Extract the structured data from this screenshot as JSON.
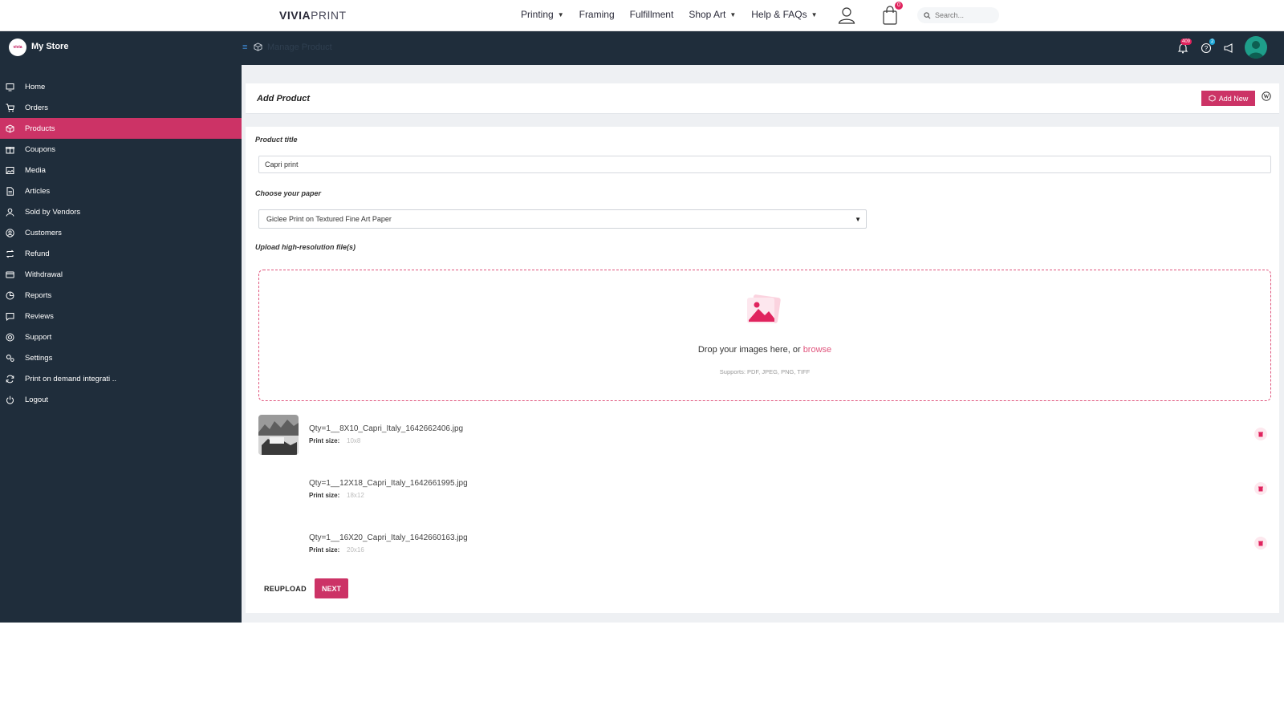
{
  "site": {
    "logo_bold": "VIVIA",
    "logo_light": "PRINT",
    "nav": [
      {
        "label": "Printing",
        "has_dropdown": true
      },
      {
        "label": "Framing",
        "has_dropdown": false
      },
      {
        "label": "Fulfillment",
        "has_dropdown": false
      },
      {
        "label": "Shop Art",
        "has_dropdown": true
      },
      {
        "label": "Help & FAQs",
        "has_dropdown": true
      }
    ],
    "cart_count": "0",
    "search_placeholder": "Search..."
  },
  "app": {
    "store_logo_text": "vivia",
    "store_name": "My Store",
    "header_title": "Manage Product",
    "notifications_count": "409",
    "help_count": "2",
    "accent_color": "#cc3366",
    "sidebar_bg": "#1f2d3b"
  },
  "sidebar": {
    "items": [
      {
        "label": "Home",
        "icon": "monitor-icon",
        "active": false
      },
      {
        "label": "Orders",
        "icon": "cart-icon",
        "active": false
      },
      {
        "label": "Products",
        "icon": "box-icon",
        "active": true
      },
      {
        "label": "Coupons",
        "icon": "gift-icon",
        "active": false
      },
      {
        "label": "Media",
        "icon": "image-icon",
        "active": false
      },
      {
        "label": "Articles",
        "icon": "document-icon",
        "active": false
      },
      {
        "label": "Sold by Vendors",
        "icon": "user-icon",
        "active": false
      },
      {
        "label": "Customers",
        "icon": "user-circle-icon",
        "active": false
      },
      {
        "label": "Refund",
        "icon": "retweet-icon",
        "active": false
      },
      {
        "label": "Withdrawal",
        "icon": "credit-card-icon",
        "active": false
      },
      {
        "label": "Reports",
        "icon": "pie-chart-icon",
        "active": false
      },
      {
        "label": "Reviews",
        "icon": "comment-icon",
        "active": false
      },
      {
        "label": "Support",
        "icon": "life-ring-icon",
        "active": false
      },
      {
        "label": "Settings",
        "icon": "cogs-icon",
        "active": false
      },
      {
        "label": "Print on demand integrati ..",
        "icon": "sync-icon",
        "active": false
      },
      {
        "label": "Logout",
        "icon": "power-icon",
        "active": false
      }
    ]
  },
  "page": {
    "title": "Add Product",
    "add_new_label": "Add New"
  },
  "form": {
    "product_title_label": "Product title",
    "product_title_value": "Capri print",
    "paper_label": "Choose your paper",
    "paper_value": "Giclee Print on Textured Fine Art Paper",
    "upload_label": "Upload high-resolution file(s)",
    "drop_text": "Drop your images here, or ",
    "browse_text": "browse",
    "supports_text": "Supports: PDF, JPEG, PNG, TIFF",
    "print_size_label": "Print size:",
    "files": [
      {
        "name": "Qty=1__8X10_Capri_Italy_1642662406.jpg",
        "print_size": "10x8",
        "has_thumbnail": true
      },
      {
        "name": "Qty=1__12X18_Capri_Italy_1642661995.jpg",
        "print_size": "18x12",
        "has_thumbnail": false
      },
      {
        "name": "Qty=1__16X20_Capri_Italy_1642660163.jpg",
        "print_size": "20x16",
        "has_thumbnail": false
      }
    ],
    "reupload_label": "REUPLOAD",
    "next_label": "NEXT"
  }
}
